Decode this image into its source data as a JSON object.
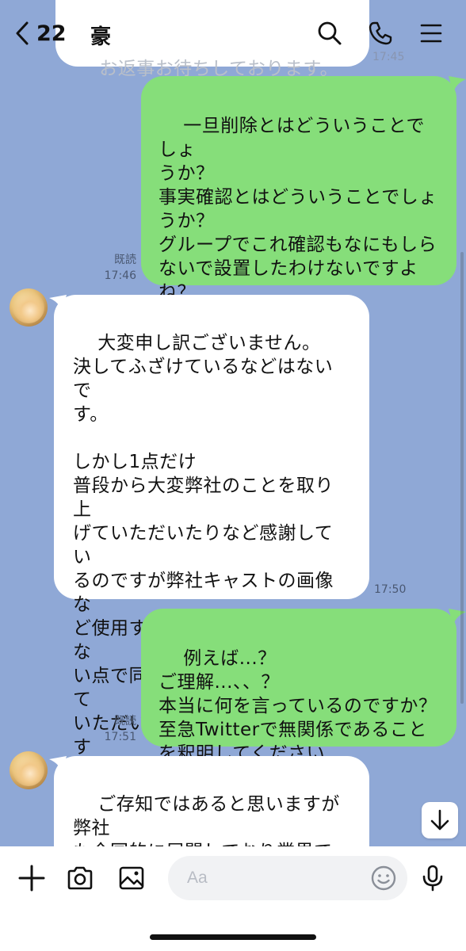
{
  "header": {
    "back_count": "22",
    "chat_name": "豪",
    "icons": [
      "search-icon",
      "phone-icon",
      "menu-icon"
    ]
  },
  "messages": [
    {
      "id": "m0",
      "direction": "in",
      "text": "お返事お待ちしております。",
      "time": "17:45"
    },
    {
      "id": "m1",
      "direction": "out",
      "text": "一旦削除とはどういうことでしょ\nうか？\n事実確認とはどういうことでしょ\nうか？\nグループでこれ確認もなにもしら\nないで設置したわけないですよ\nね？\nふざけてますか？",
      "read": "既読",
      "time": "17:46"
    },
    {
      "id": "m2",
      "direction": "in",
      "text": "大変申し訳ございません。\n決してふざけているなどはないで\nす。\n\nしかし1点だけ\n普段から大変弊社のことを取り上\nげていただいたりなど感謝してい\nるのですが弊社キャストの画像な\nど使用する際に許可をだしていな\nい点で同様にこちらも使用させて\nいただいた流れは例えばなのです\nがご理解いただけたりしますか...",
      "time": "17:50"
    },
    {
      "id": "m3",
      "direction": "out",
      "text": "例えば...？\nご理解...、、？\n本当に何を言っているのですか？\n至急Twitterで無関係であること\nを釈明してください",
      "read": "既読",
      "time": "17:51"
    },
    {
      "id": "m4",
      "direction": "in",
      "text": "ご存知ではあると思いますが弊社\nも全国的に展開しており業界での\n立場も確立しております"
    }
  ],
  "input": {
    "placeholder": "Aa",
    "value": ""
  },
  "colors": {
    "background": "#8fa8d6",
    "outgoing_bubble": "#86de7a",
    "incoming_bubble": "#ffffff"
  }
}
